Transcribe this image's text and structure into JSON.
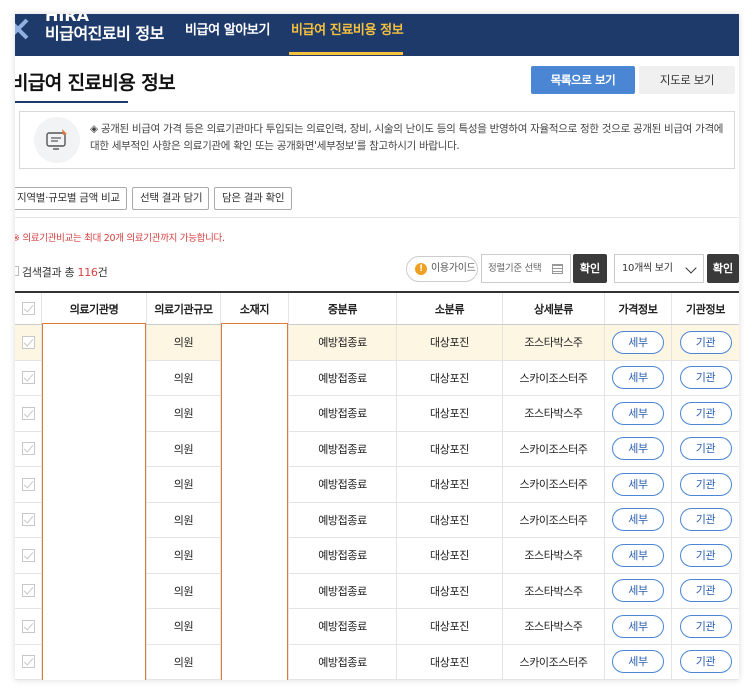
{
  "header": {
    "logo_top": "HIRA",
    "logo_sub": "비급여진료비 정보",
    "nav": [
      "비급여 알아보기",
      "비급여 진료비용 정보"
    ]
  },
  "page": {
    "title": "비급여 진료비용 정보",
    "view_list": "목록으로 보기",
    "view_map": "지도로 보기"
  },
  "notice": {
    "text": "◈ 공개된 비급여 가격 등은 의료기관마다 투입되는 의료인력, 장비, 시술의 난이도 등의 특성을 반영하여 자율적으로 정한 것으로 공개된 비급여 가격에 대한 세부적인 사항은 의료기관에 확인 또는 공개화면'세부정보'를 참고하시기 바랍니다."
  },
  "actions": [
    "지역별·규모별 금액 비교",
    "선택 결과 담기",
    "담은 결과 확인"
  ],
  "warning": "※ 의료기관비교는 최대 20개 의료기관까지 가능합니다.",
  "results": {
    "prefix": "검색결과 총 ",
    "count": "116",
    "suffix": "건",
    "guide": "이용가이드",
    "sort_placeholder": "정렬기준 선택",
    "confirm": "확인",
    "page_size": "10개씩 보기"
  },
  "table": {
    "headers": [
      "의료기관명",
      "의료기관규모",
      "소재지",
      "중분류",
      "소분류",
      "상세분류",
      "가격정보",
      "기관정보"
    ],
    "rows": [
      {
        "size": "의원",
        "mid": "예방접종료",
        "small": "대상포진",
        "detail": "조스타박스주",
        "price": "세부",
        "org": "기관"
      },
      {
        "size": "의원",
        "mid": "예방접종료",
        "small": "대상포진",
        "detail": "스카이조스터주",
        "price": "세부",
        "org": "기관"
      },
      {
        "size": "의원",
        "mid": "예방접종료",
        "small": "대상포진",
        "detail": "조스타박스주",
        "price": "세부",
        "org": "기관"
      },
      {
        "size": "의원",
        "mid": "예방접종료",
        "small": "대상포진",
        "detail": "스카이조스터주",
        "price": "세부",
        "org": "기관"
      },
      {
        "size": "의원",
        "mid": "예방접종료",
        "small": "대상포진",
        "detail": "스카이조스터주",
        "price": "세부",
        "org": "기관"
      },
      {
        "size": "의원",
        "mid": "예방접종료",
        "small": "대상포진",
        "detail": "스카이조스터주",
        "price": "세부",
        "org": "기관"
      },
      {
        "size": "의원",
        "mid": "예방접종료",
        "small": "대상포진",
        "detail": "조스타박스주",
        "price": "세부",
        "org": "기관"
      },
      {
        "size": "의원",
        "mid": "예방접종료",
        "small": "대상포진",
        "detail": "조스타박스주",
        "price": "세부",
        "org": "기관"
      },
      {
        "size": "의원",
        "mid": "예방접종료",
        "small": "대상포진",
        "detail": "조스타박스주",
        "price": "세부",
        "org": "기관"
      },
      {
        "size": "의원",
        "mid": "예방접종료",
        "small": "대상포진",
        "detail": "스카이조스터주",
        "price": "세부",
        "org": "기관"
      }
    ]
  },
  "colors": {
    "header_bg": "#1d3a6b",
    "accent_yellow": "#f5c03d",
    "primary_blue": "#4a86d4",
    "warning_red": "#d64040"
  }
}
